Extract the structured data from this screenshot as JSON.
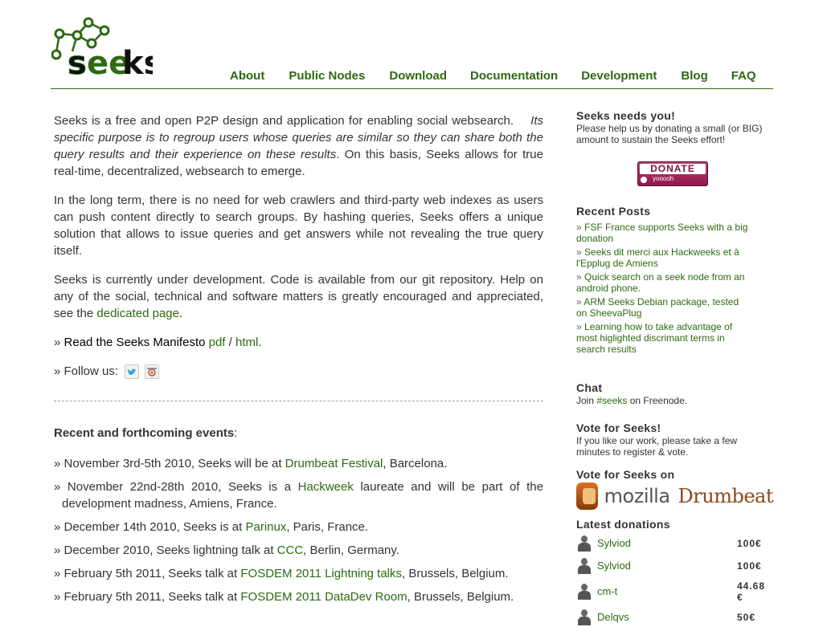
{
  "logo": {
    "alt": "Seeks"
  },
  "nav": [
    {
      "label": "About"
    },
    {
      "label": "Public Nodes"
    },
    {
      "label": "Download"
    },
    {
      "label": "Documentation"
    },
    {
      "label": "Development"
    },
    {
      "label": "Blog"
    },
    {
      "label": "FAQ"
    }
  ],
  "main": {
    "p1_start": "Seeks is a free and open P2P design and application for enabling social websearch.",
    "p1_italic": "Its specific purpose is to regroup users whose queries are similar so they can share both the query results and their experience on these results",
    "p1_end": ". On this basis, Seeks allows for true real-time, decentralized, websearch to emerge.",
    "p2": "In the long term, there is no need for web crawlers and third-party web indexes as users can push content directly to search groups. By hashing queries, Seeks offers a unique solution that allows to issue queries and get answers while not revealing the true query itself.",
    "p3_start": "Seeks is currently under development. Code is available from our git repository. Help on any of the social, technical and software matters is greatly encouraged and appreciated, see the",
    "p3_link": "dedicated page",
    "p3_end": ".",
    "manifesto_prefix": "» ",
    "manifesto_label": "Read the Seeks Manifesto",
    "manifesto_pdf": "pdf",
    "manifesto_sep": " / ",
    "manifesto_html": "html",
    "manifesto_end": ".",
    "follow_label": "» Follow us:",
    "events_title": "Recent and forthcoming events",
    "events_colon": ":",
    "events": [
      {
        "pre": "» November 3rd-5th 2010, Seeks will be at ",
        "link": "Drumbeat Festival",
        "post": ", Barcelona."
      },
      {
        "pre": "» November 22nd-28th 2010, Seeks is a ",
        "link": "Hackweek",
        "post": " laureate and will be part of the development madness, Amiens, France."
      },
      {
        "pre": "» December 14th 2010, Seeks is at ",
        "link": "Parinux",
        "post": ", Paris, France."
      },
      {
        "pre": "» December 2010, Seeks lightning talk at ",
        "link": "CCC",
        "post": ", Berlin, Germany."
      },
      {
        "pre": "» February 5th 2011, Seeks talk at ",
        "link": "FOSDEM 2011 Lightning talks",
        "post": ", Brussels, Belgium."
      },
      {
        "pre": "» February 5th 2011, Seeks talk at ",
        "link": "FOSDEM 2011 DataDev Room",
        "post": ", Brussels, Belgium."
      }
    ]
  },
  "sidebar": {
    "needs_title": "Seeks needs you!",
    "needs_text": "Please help us by donating a small (or BIG) amount to sustain the Seeks effort!",
    "donate_label": "DONATE",
    "donate_sub": "yooooh",
    "recent_title": "Recent Posts",
    "posts": [
      {
        "label": "FSF France supports Seeks with a big donation"
      },
      {
        "label": "Seeks dit merci aux Hackweeks et à l'Epplug de Amiens"
      },
      {
        "label": "Quick search on a seek node from an android phone."
      },
      {
        "label": "ARM Seeks Debian package, tested on SheevaPlug"
      },
      {
        "label": "Learning how to take advantage of most higlighted discrimant terms in search results"
      }
    ],
    "chat_title": "Chat",
    "chat_pre": "Join ",
    "chat_link": "#seeks",
    "chat_post": " on Freenode.",
    "vote_title": "Vote for Seeks!",
    "vote_text": "If you like our work, please take a few minutes to register & vote.",
    "vote_on_title": "Vote for Seeks on",
    "mozilla_text": "mozilla",
    "drumbeat_text": "Drumbeat",
    "donations_title": "Latest donations",
    "donations": [
      {
        "name": "Sylviod",
        "amount": "100€"
      },
      {
        "name": "Sylviod",
        "amount": "100€"
      },
      {
        "name": "cm-t",
        "amount": "44.68 €"
      },
      {
        "name": "Delqvs",
        "amount": "50€"
      }
    ],
    "colors": {
      "accent": "#2d6a12",
      "donate": "#a8245c"
    }
  }
}
